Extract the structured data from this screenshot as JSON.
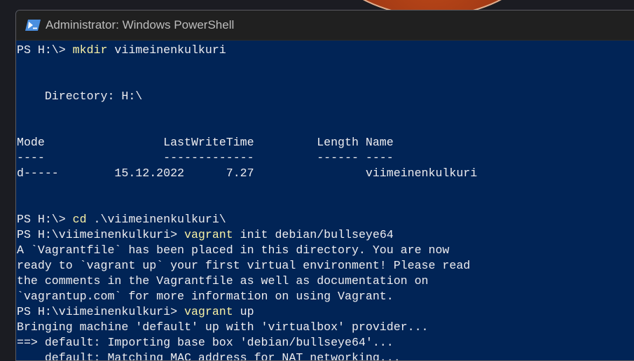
{
  "window": {
    "title": "Administrator: Windows PowerShell",
    "icon": "powershell-icon",
    "colors": {
      "background": "#012456",
      "text": "#eeedf0",
      "command": "#f9f1a5",
      "titlebar": "#202020"
    }
  },
  "console": {
    "lines": [
      {
        "type": "command",
        "prompt": "PS H:\\> ",
        "command": "mkdir",
        "args": " viimeinenkulkuri"
      },
      {
        "type": "text",
        "text": ""
      },
      {
        "type": "text",
        "text": ""
      },
      {
        "type": "text",
        "text": "    Directory: H:\\"
      },
      {
        "type": "text",
        "text": ""
      },
      {
        "type": "text",
        "text": ""
      },
      {
        "type": "text",
        "text": "Mode                 LastWriteTime         Length Name"
      },
      {
        "type": "text",
        "text": "----                 -------------         ------ ----"
      },
      {
        "type": "text",
        "text": "d-----        15.12.2022      7.27                viimeinenkulkuri"
      },
      {
        "type": "text",
        "text": ""
      },
      {
        "type": "text",
        "text": ""
      },
      {
        "type": "command",
        "prompt": "PS H:\\> ",
        "command": "cd",
        "args": " .\\viimeinenkulkuri\\"
      },
      {
        "type": "command",
        "prompt": "PS H:\\viimeinenkulkuri> ",
        "command": "vagrant",
        "args": " init debian/bullseye64"
      },
      {
        "type": "text",
        "text": "A `Vagrantfile` has been placed in this directory. You are now"
      },
      {
        "type": "text",
        "text": "ready to `vagrant up` your first virtual environment! Please read"
      },
      {
        "type": "text",
        "text": "the comments in the Vagrantfile as well as documentation on"
      },
      {
        "type": "text",
        "text": "`vagrantup.com` for more information on using Vagrant."
      },
      {
        "type": "command",
        "prompt": "PS H:\\viimeinenkulkuri> ",
        "command": "vagrant",
        "args": " up"
      },
      {
        "type": "text",
        "text": "Bringing machine 'default' up with 'virtualbox' provider..."
      },
      {
        "type": "text",
        "text": "==> default: Importing base box 'debian/bullseye64'..."
      },
      {
        "type": "text",
        "text": "    default: Matching MAC address for NAT networking..."
      }
    ]
  }
}
